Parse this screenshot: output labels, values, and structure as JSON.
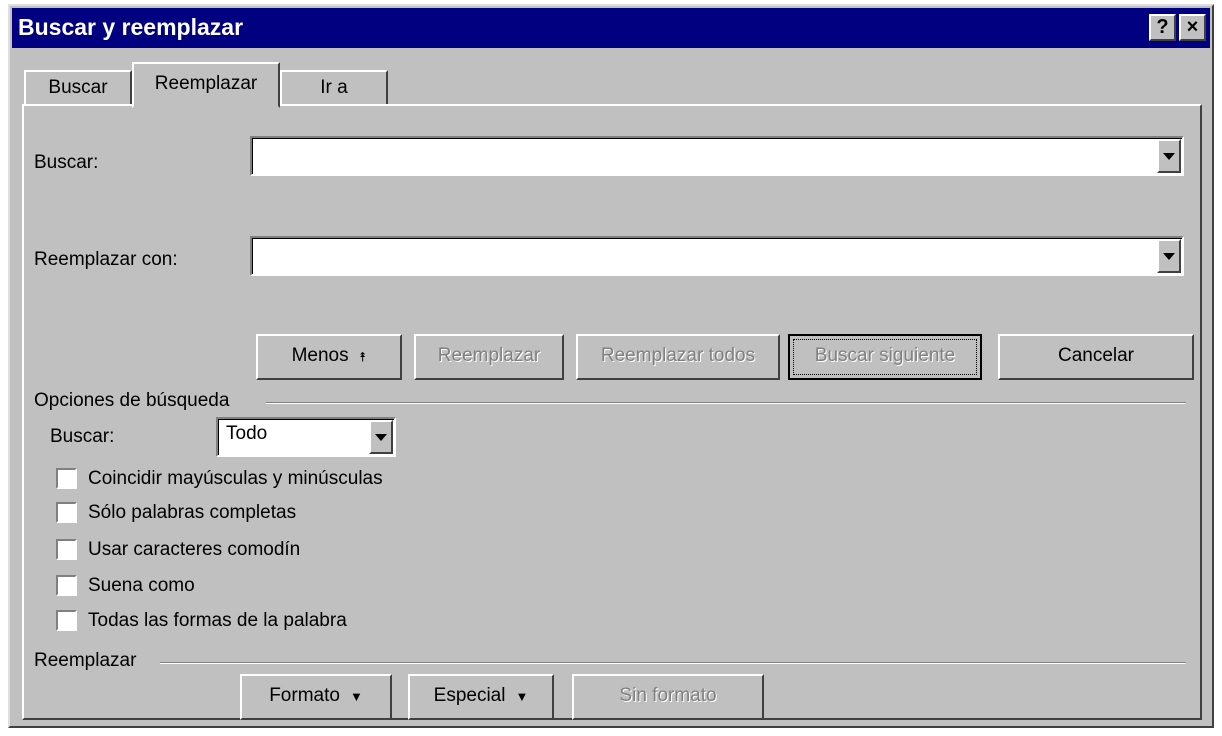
{
  "window": {
    "title": "Buscar y reemplazar",
    "help_glyph": "?",
    "close_glyph": "×"
  },
  "tabs": [
    {
      "label": "Buscar"
    },
    {
      "label": "Reemplazar"
    },
    {
      "label": "Ir a"
    }
  ],
  "active_tab": "Reemplazar",
  "fields": {
    "find_label": "Buscar:",
    "find_value": "",
    "replace_label": "Reemplazar con:",
    "replace_value": ""
  },
  "buttons": {
    "less": "Menos",
    "less_glyph": "⯭",
    "replace": "Reemplazar",
    "replace_all": "Reemplazar todos",
    "find_next": "Buscar siguiente",
    "cancel": "Cancelar"
  },
  "search_options": {
    "group_label": "Opciones de búsqueda",
    "search_label": "Buscar:",
    "search_value": "Todo",
    "checkboxes": [
      {
        "label": "Coincidir mayúsculas y minúsculas",
        "checked": false
      },
      {
        "label": "Sólo palabras completas",
        "checked": false
      },
      {
        "label": "Usar caracteres comodín",
        "checked": false
      },
      {
        "label": "Suena como",
        "checked": false
      },
      {
        "label": "Todas las formas de la palabra",
        "checked": false
      }
    ]
  },
  "replace_section": {
    "group_label": "Reemplazar",
    "format": "Formato",
    "special": "Especial",
    "no_format": "Sin formato",
    "menu_glyph": "▼"
  }
}
